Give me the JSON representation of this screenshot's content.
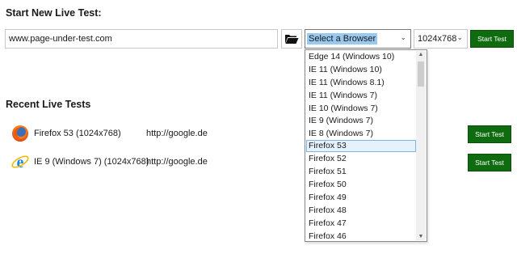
{
  "start": {
    "heading": "Start New Live Test:",
    "url_value": "www.page-under-test.com",
    "browser_select": "Select a Browser",
    "resolution_select": "1024x768",
    "start_label": "Start Test"
  },
  "dropdown": {
    "items": [
      "Edge 14 (Windows 10)",
      "IE 11 (Windows 10)",
      "IE 11 (Windows 8.1)",
      "IE 11 (Windows 7)",
      "IE 10 (Windows 7)",
      "IE 9 (Windows 7)",
      "IE 8 (Windows 7)",
      "Firefox 53",
      "Firefox 52",
      "Firefox 51",
      "Firefox 50",
      "Firefox 49",
      "Firefox 48",
      "Firefox 47",
      "Firefox 46"
    ],
    "highlighted": "Firefox 53"
  },
  "recent": {
    "heading": "Recent Live Tests",
    "tests": [
      {
        "name": "Firefox 53 (1024x768)",
        "url": "http://google.de",
        "icon": "firefox-icon",
        "button": "Start Test"
      },
      {
        "name": "IE 9 (Windows 7) (1024x768)",
        "url": "http://google.de",
        "icon": "ie-icon",
        "button": "Start Test"
      }
    ]
  },
  "colors": {
    "accent_green": "#0f6b0f",
    "selection_blue": "#99c9ef",
    "hover_blue": "#e5f1fb"
  }
}
